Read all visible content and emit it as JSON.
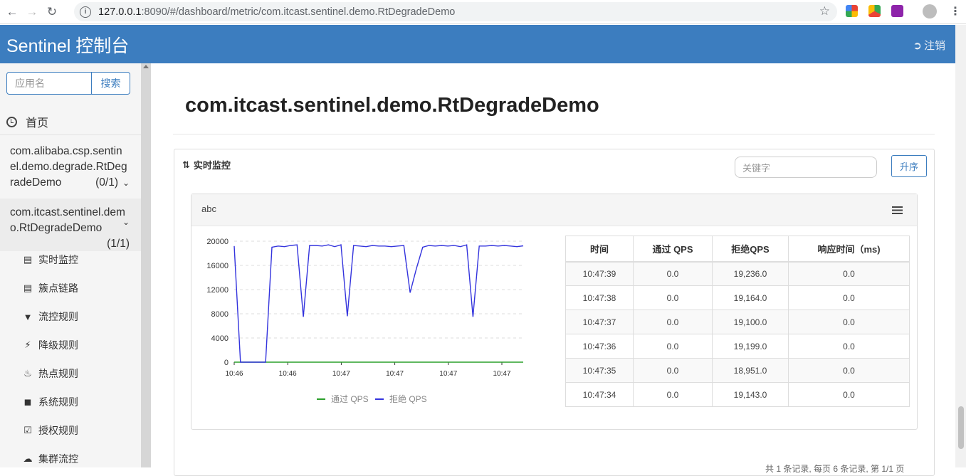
{
  "browser": {
    "url_host": "127.0.0.1",
    "url_rest": ":8090/#/dashboard/metric/com.itcast.sentinel.demo.RtDegradeDemo"
  },
  "header": {
    "brand": "Sentinel 控制台",
    "logout": "注销"
  },
  "sidebar": {
    "search_placeholder": "应用名",
    "search_button": "搜索",
    "home": "首页",
    "apps": [
      {
        "name_lines": [
          "com.alibaba.csp.sentin",
          "el.demo.degrade.RtDeg",
          "radeDemo"
        ],
        "count": "(0/1)"
      },
      {
        "name_lines": [
          "com.itcast.sentinel.dem",
          "o.RtDegradeDemo"
        ],
        "count": "(1/1)"
      }
    ],
    "menu": [
      {
        "label": "实时监控",
        "icon": "bar-chart-icon"
      },
      {
        "label": "簇点链路",
        "icon": "list-icon"
      },
      {
        "label": "流控规则",
        "icon": "filter-icon"
      },
      {
        "label": "降级规则",
        "icon": "flash-icon"
      },
      {
        "label": "热点规则",
        "icon": "fire-icon"
      },
      {
        "label": "系统规则",
        "icon": "lock-icon"
      },
      {
        "label": "授权规则",
        "icon": "check-icon"
      },
      {
        "label": "集群流控",
        "icon": "cloud-icon"
      }
    ]
  },
  "main": {
    "title": "com.itcast.sentinel.demo.RtDegradeDemo",
    "panel_title": "实时监控",
    "keyword_placeholder": "关键字",
    "sort_button": "升序",
    "resource": "abc",
    "table": {
      "headers": [
        "时间",
        "通过 QPS",
        "拒绝QPS",
        "响应时间（ms)"
      ],
      "rows": [
        [
          "10:47:39",
          "0.0",
          "19,236.0",
          "0.0"
        ],
        [
          "10:47:38",
          "0.0",
          "19,164.0",
          "0.0"
        ],
        [
          "10:47:37",
          "0.0",
          "19,100.0",
          "0.0"
        ],
        [
          "10:47:36",
          "0.0",
          "19,199.0",
          "0.0"
        ],
        [
          "10:47:35",
          "0.0",
          "18,951.0",
          "0.0"
        ],
        [
          "10:47:34",
          "0.0",
          "19,143.0",
          "0.0"
        ]
      ]
    },
    "pager_hint": "共 1 条记录, 每页 6 条记录, 第 1/1 页"
  },
  "chart_data": {
    "type": "line",
    "x_tick_labels": [
      "10:46",
      "10:46",
      "10:47",
      "10:47",
      "10:47",
      "10:47"
    ],
    "y_ticks": [
      0,
      4000,
      8000,
      12000,
      16000,
      20000
    ],
    "ylim": [
      0,
      20000
    ],
    "legend_position": "bottom",
    "series": [
      {
        "name": "通过 QPS",
        "color": "#2ca02c",
        "values": [
          0,
          0,
          0,
          0,
          0,
          0,
          0,
          0,
          0,
          0,
          0,
          0,
          0,
          0,
          0,
          0,
          0,
          0,
          0,
          0,
          0,
          0,
          0,
          0,
          0,
          0,
          0,
          0,
          0,
          0,
          0,
          0,
          0,
          0,
          0,
          0,
          0,
          0,
          0,
          0,
          0,
          0,
          0,
          0,
          0,
          0,
          0,
          0,
          0,
          0,
          0,
          0,
          0,
          0,
          0,
          0,
          0,
          0,
          0,
          0
        ]
      },
      {
        "name": "拒绝 QPS",
        "color": "#3333dd",
        "values": [
          19200,
          0,
          0,
          0,
          0,
          0,
          19000,
          19200,
          19100,
          19300,
          19400,
          7500,
          19300,
          19300,
          19200,
          19400,
          19100,
          19400,
          7600,
          19300,
          19200,
          19100,
          19300,
          19200,
          19200,
          19100,
          19200,
          19300,
          11500,
          15500,
          19000,
          19300,
          19200,
          19300,
          19200,
          19300,
          19100,
          19400,
          7500,
          19200,
          19200,
          19300,
          19200,
          19300,
          19200,
          19100,
          19236
        ]
      }
    ]
  }
}
